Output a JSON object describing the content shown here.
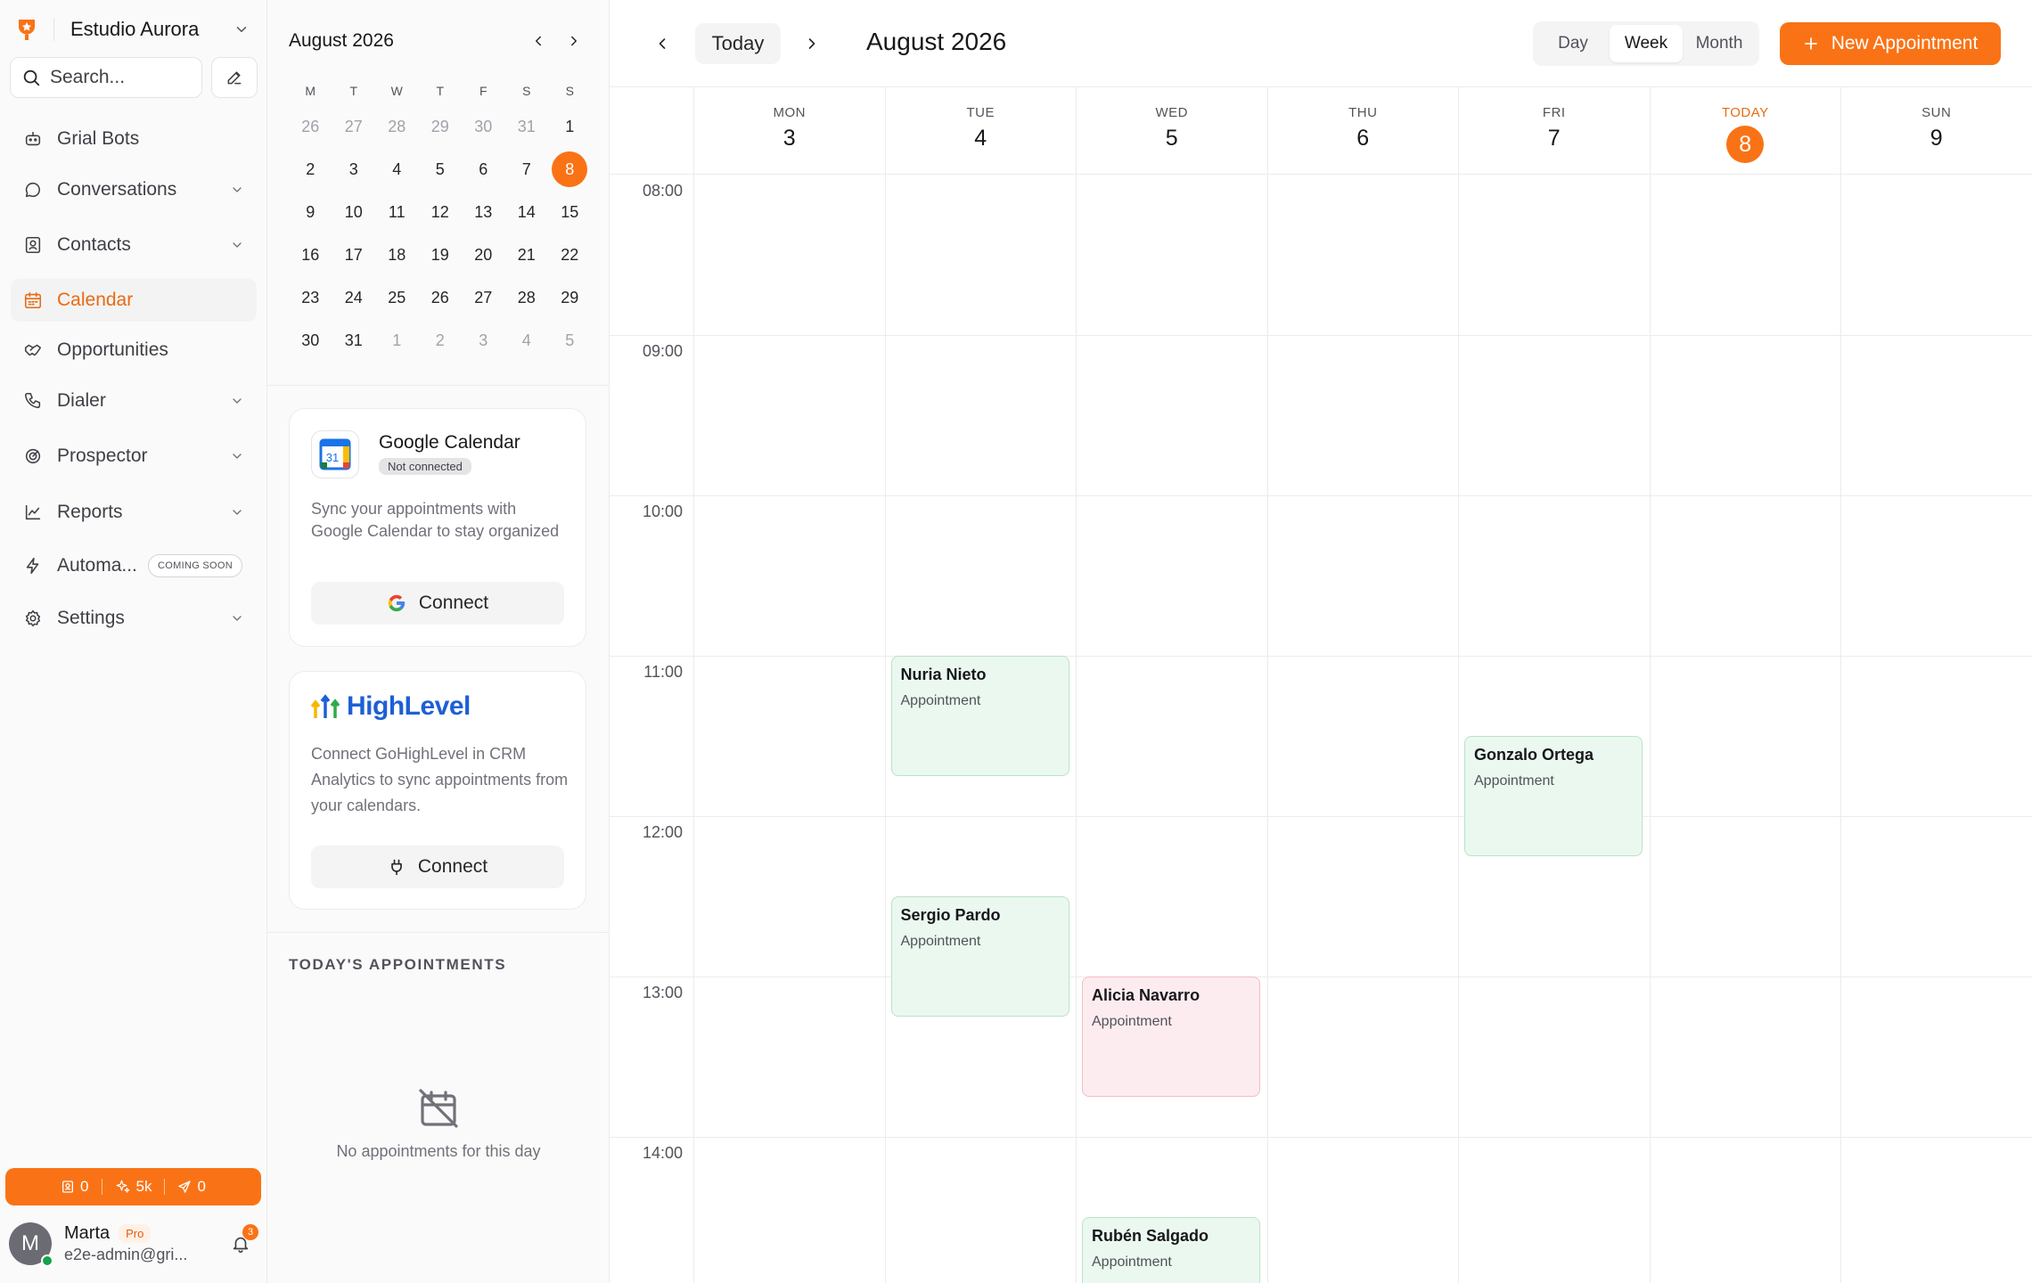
{
  "workspace": {
    "name": "Estudio Aurora"
  },
  "search": {
    "placeholder": "Search..."
  },
  "nav": [
    {
      "label": "Grial Bots",
      "icon": "bot-icon",
      "has_chevron": false
    },
    {
      "label": "Conversations",
      "icon": "chat-icon",
      "has_chevron": true
    },
    {
      "label": "Contacts",
      "icon": "contacts-icon",
      "has_chevron": true
    },
    {
      "label": "Calendar",
      "icon": "calendar-icon",
      "has_chevron": false,
      "active": true
    },
    {
      "label": "Opportunities",
      "icon": "handshake-icon",
      "has_chevron": false
    },
    {
      "label": "Dialer",
      "icon": "phone-icon",
      "has_chevron": true
    },
    {
      "label": "Prospector",
      "icon": "radar-icon",
      "has_chevron": true
    },
    {
      "label": "Reports",
      "icon": "chart-icon",
      "has_chevron": true
    },
    {
      "label": "Automa...",
      "icon": "bolt-icon",
      "badge": "COMING SOON"
    },
    {
      "label": "Settings",
      "icon": "gear-icon",
      "has_chevron": true
    }
  ],
  "credits": {
    "contacts": "0",
    "sparkles": "5k",
    "sent": "0"
  },
  "user": {
    "initial": "M",
    "name": "Marta",
    "plan": "Pro",
    "email": "e2e-admin@gri...",
    "notifications": "3"
  },
  "mini_calendar": {
    "title": "August 2026",
    "weekdays": [
      "M",
      "T",
      "W",
      "T",
      "F",
      "S",
      "S"
    ],
    "weeks": [
      [
        "26",
        "27",
        "28",
        "29",
        "30",
        "31",
        "1"
      ],
      [
        "2",
        "3",
        "4",
        "5",
        "6",
        "7",
        "8"
      ],
      [
        "9",
        "10",
        "11",
        "12",
        "13",
        "14",
        "15"
      ],
      [
        "16",
        "17",
        "18",
        "19",
        "20",
        "21",
        "22"
      ],
      [
        "23",
        "24",
        "25",
        "26",
        "27",
        "28",
        "29"
      ],
      [
        "30",
        "31",
        "1",
        "2",
        "3",
        "4",
        "5"
      ]
    ],
    "selected": "8"
  },
  "google_card": {
    "title": "Google Calendar",
    "status": "Not connected",
    "description": "Sync your appointments with Google Calendar to stay organized",
    "button": "Connect"
  },
  "highlevel_card": {
    "logo_text": "HighLevel",
    "description": "Connect GoHighLevel in CRM Analytics to sync appointments from your calendars.",
    "button": "Connect"
  },
  "todays": {
    "title": "TODAY'S APPOINTMENTS",
    "empty": "No appointments for this day"
  },
  "toolbar": {
    "today": "Today",
    "title": "August 2026",
    "views": [
      "Day",
      "Week",
      "Month"
    ],
    "active_view": "Week",
    "new_button": "New Appointment"
  },
  "colors": {
    "accent": "#f97316",
    "event_green": "#ebf8ef",
    "event_red": "#fdecef"
  },
  "week": [
    {
      "name": "MON",
      "date": "3"
    },
    {
      "name": "TUE",
      "date": "4"
    },
    {
      "name": "WED",
      "date": "5"
    },
    {
      "name": "THU",
      "date": "6"
    },
    {
      "name": "FRI",
      "date": "7"
    },
    {
      "name": "TODAY",
      "date": "8",
      "today": true
    },
    {
      "name": "SUN",
      "date": "9"
    }
  ],
  "hours": [
    "08:00",
    "09:00",
    "10:00",
    "11:00",
    "12:00",
    "13:00",
    "14:00"
  ],
  "events": [
    {
      "name": "Nuria Nieto",
      "subtitle": "Appointment",
      "day": 1,
      "start": "11:00",
      "end": "11:45",
      "color": "green"
    },
    {
      "name": "Sergio Pardo",
      "subtitle": "Appointment",
      "day": 1,
      "start": "12:30",
      "end": "13:15",
      "color": "green"
    },
    {
      "name": "Alicia Navarro",
      "subtitle": "Appointment",
      "day": 2,
      "start": "13:00",
      "end": "13:45",
      "color": "red"
    },
    {
      "name": "Rubén Salgado",
      "subtitle": "Appointment",
      "day": 2,
      "start": "14:30",
      "end": "15:15",
      "color": "green"
    },
    {
      "name": "Gonzalo Ortega",
      "subtitle": "Appointment",
      "day": 4,
      "start": "11:30",
      "end": "12:15",
      "color": "green"
    }
  ]
}
